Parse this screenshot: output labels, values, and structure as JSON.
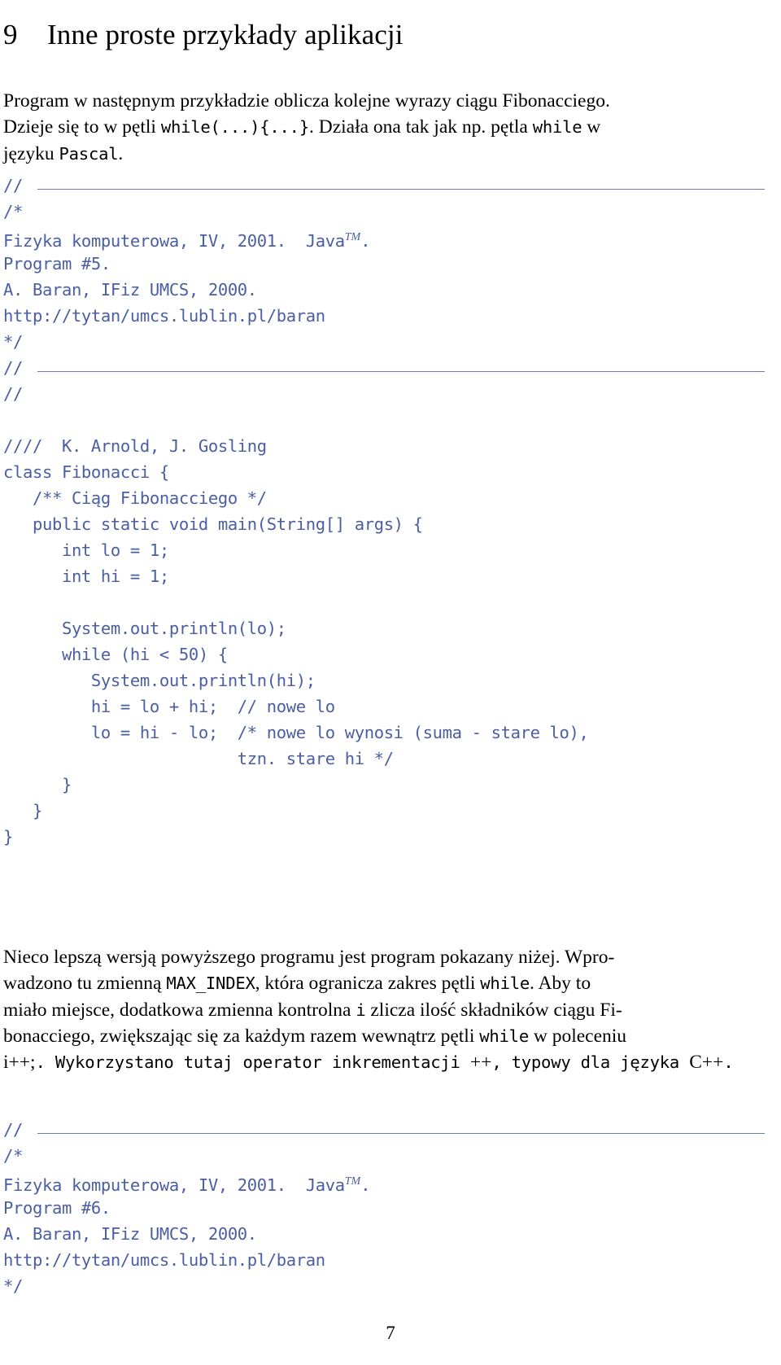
{
  "document": {
    "language": "pl",
    "page_number": "7"
  },
  "heading": {
    "number": "9",
    "title": "Inne proste przykłady aplikacji"
  },
  "paragraph1": {
    "lines": [
      [
        "Program w następnym przykładzie oblicza kolejne wyrazy ciągu Fibonacciego."
      ],
      [
        "Dzieje się to w pętli ",
        "while(...){...}",
        ". Działa ona tak jak np. pętla ",
        "while",
        " w"
      ],
      [
        "języku ",
        "Pascal",
        "."
      ]
    ]
  },
  "code_block_1": {
    "lines": [
      {
        "text": "//",
        "rule": true
      },
      {
        "text": "/*",
        "rule": false
      },
      {
        "text": "Fizyka komputerowa, IV, 2001.  Java",
        "sup": "TM",
        "after": ".",
        "rule": false
      },
      {
        "text": "Program #5.",
        "rule": false
      },
      {
        "text": "A. Baran, IFiz UMCS, 2000.",
        "rule": false
      },
      {
        "text": "http://tytan/umcs.lublin.pl/baran",
        "rule": false
      },
      {
        "text": "*/",
        "rule": false
      },
      {
        "text": "//",
        "rule": true
      },
      {
        "text": "//",
        "rule": false
      },
      {
        "text": "",
        "rule": false
      },
      {
        "text": "////  K. Arnold, J. Gosling",
        "rule": false
      },
      {
        "text": "class Fibonacci {",
        "rule": false
      },
      {
        "text": "   /** Ciąg Fibonacciego */",
        "rule": false
      },
      {
        "text": "   public static void main(String[] args) {",
        "rule": false
      },
      {
        "text": "      int lo = 1;",
        "rule": false
      },
      {
        "text": "      int hi = 1;",
        "rule": false
      },
      {
        "text": "",
        "rule": false
      },
      {
        "text": "      System.out.println(lo);",
        "rule": false
      },
      {
        "text": "      while (hi < 50) {",
        "rule": false
      },
      {
        "text": "         System.out.println(hi);",
        "rule": false
      },
      {
        "text": "         hi = lo + hi;  // nowe lo",
        "rule": false
      },
      {
        "text": "         lo = hi - lo;  /* nowe lo wynosi (suma - stare lo),",
        "rule": false
      },
      {
        "text": "                        tzn. stare hi */",
        "rule": false
      },
      {
        "text": "      }",
        "rule": false
      },
      {
        "text": "   }",
        "rule": false
      },
      {
        "text": "}",
        "rule": false
      }
    ]
  },
  "paragraph2": {
    "lines": [
      [
        "      Nieco lepszą wersją powyższego programu jest program pokazany niżej. Wpro-"
      ],
      [
        "wadzono tu zmienną ",
        "MAX_INDEX",
        ", która ogranicza zakres pętli ",
        "while",
        ". Aby to"
      ],
      [
        "miało miejsce, dodatkowa zmienna kontrolna ",
        "i",
        " zlicza ilość składników ciągu Fi-"
      ],
      [
        "bonacciego, zwiększając się za każdym razem wewnątrz pętli ",
        "while",
        " w poleceniu"
      ],
      [
        "i++;",
        ". Wykorzystano tutaj operator inkrementacji ",
        "++",
        ", typowy dla języka ",
        "C++",
        "."
      ]
    ]
  },
  "code_block_2": {
    "lines": [
      {
        "text": "//",
        "rule": true
      },
      {
        "text": "/*",
        "rule": false
      },
      {
        "text": "Fizyka komputerowa, IV, 2001.  Java",
        "sup": "TM",
        "after": ".",
        "rule": false
      },
      {
        "text": "Program #6.",
        "rule": false
      },
      {
        "text": "A. Baran, IFiz UMCS, 2000.",
        "rule": false
      },
      {
        "text": "http://tytan/umcs.lublin.pl/baran",
        "rule": false
      },
      {
        "text": "*/",
        "rule": false
      }
    ]
  },
  "colors": {
    "code_blue": "#4b5ea1",
    "rule_blue": "#6a7fb8",
    "body_text": "#000000",
    "page_background": "#ffffff"
  }
}
